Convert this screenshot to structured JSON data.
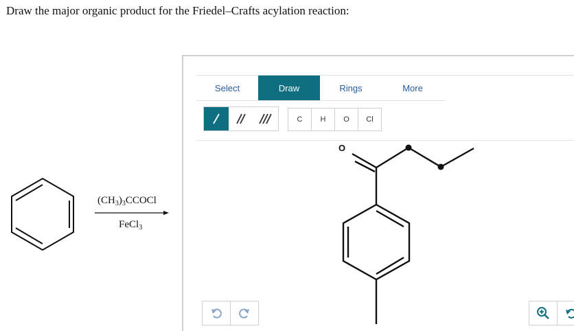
{
  "question": {
    "text": "Draw the major organic product for the Friedel–Crafts acylation reaction:"
  },
  "reaction": {
    "reagent_main": "(CH",
    "reagent_sub1": "3",
    "reagent_mid": ")",
    "reagent_sub2": "3",
    "reagent_end": "CCOCl",
    "catalyst_main": "FeCl",
    "catalyst_sub": "3"
  },
  "toolbar": {
    "tabs": [
      {
        "label": "Select"
      },
      {
        "label": "Draw"
      },
      {
        "label": "Rings"
      },
      {
        "label": "More"
      }
    ],
    "active_tab": "Draw",
    "bond_tools": [
      "single-bond",
      "double-bond",
      "triple-bond"
    ],
    "atoms": [
      {
        "label": "C"
      },
      {
        "label": "H"
      },
      {
        "label": "O"
      },
      {
        "label": "Cl"
      }
    ]
  },
  "canvas": {
    "carbonyl_oxygen_label": "O"
  },
  "colors": {
    "accent": "#0e6f80",
    "tab_text": "#2a5c9a",
    "border": "#cfcfcf"
  }
}
